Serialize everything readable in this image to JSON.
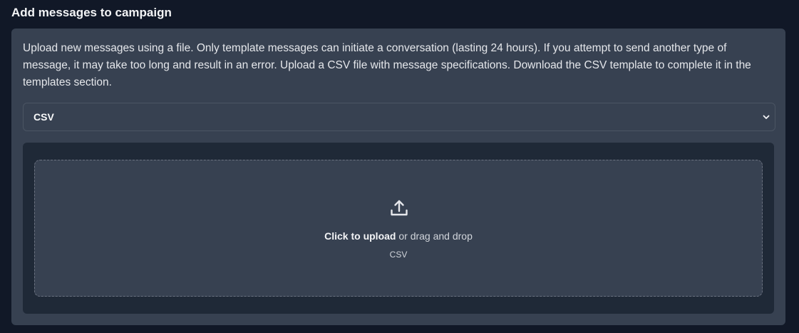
{
  "section": {
    "title": "Add messages to campaign"
  },
  "card": {
    "description": "Upload new messages using a file. Only template messages can initiate a conversation (lasting 24 hours). If you attempt to send another type of message, it may take too long and result in an error. Upload a CSV file with message specifications. Download the CSV template to complete it in the templates section."
  },
  "file_type_select": {
    "selected_value": "CSV",
    "icon": "chevron-down-icon"
  },
  "upload": {
    "icon": "upload-icon",
    "click_label": "Click to upload",
    "drag_label": " or drag and drop",
    "accepted_formats": "CSV"
  },
  "colors": {
    "page_background": "#111827",
    "card_background": "#374151",
    "upload_well_background": "#1f2937",
    "dropzone_border": "#6b7280",
    "text_primary": "#f3f4f6",
    "text_secondary": "#d1d5db"
  }
}
